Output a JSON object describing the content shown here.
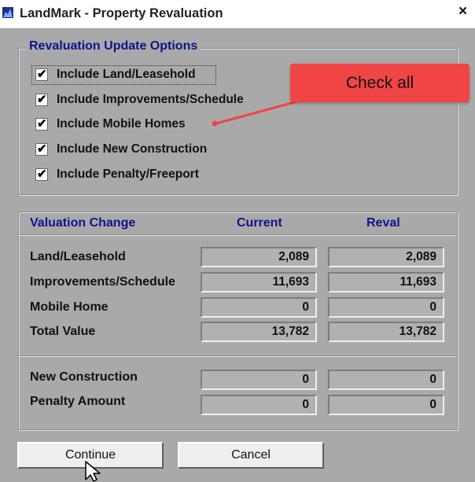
{
  "window": {
    "title": "LandMark - Property Revaluation",
    "close_glyph": "×",
    "app_icon": "chart-app-icon"
  },
  "options": {
    "group_title": "Revaluation Update Options",
    "items": [
      {
        "label": "Include Land/Leasehold",
        "checked": true,
        "mark": "✔"
      },
      {
        "label": "Include Improvements/Schedule",
        "checked": true,
        "mark": "✔"
      },
      {
        "label": "Include Mobile Homes",
        "checked": true,
        "mark": "✔"
      },
      {
        "label": "Include New Construction",
        "checked": true,
        "mark": "✔"
      },
      {
        "label": "Include Penalty/Freeport",
        "checked": true,
        "mark": "✔"
      }
    ]
  },
  "callout": {
    "text": "Check all",
    "color": "#f04545"
  },
  "valuation": {
    "headers": {
      "label": "Valuation Change",
      "current": "Current",
      "reval": "Reval"
    },
    "rows": [
      {
        "label": "Land/Leasehold",
        "current": "2,089",
        "reval": "2,089"
      },
      {
        "label": "Improvements/Schedule",
        "current": "11,693",
        "reval": "11,693"
      },
      {
        "label": "Mobile Home",
        "current": "0",
        "reval": "0"
      },
      {
        "label": "Total Value",
        "current": "13,782",
        "reval": "13,782"
      }
    ],
    "extra_rows": [
      {
        "label": "New Construction",
        "current": "0",
        "reval": "0"
      },
      {
        "label": "Penalty Amount",
        "current": "0",
        "reval": "0"
      }
    ]
  },
  "buttons": {
    "continue": "Continue",
    "cancel": "Cancel"
  },
  "colors": {
    "header_text": "#10138a",
    "background": "#a9a9a9"
  }
}
